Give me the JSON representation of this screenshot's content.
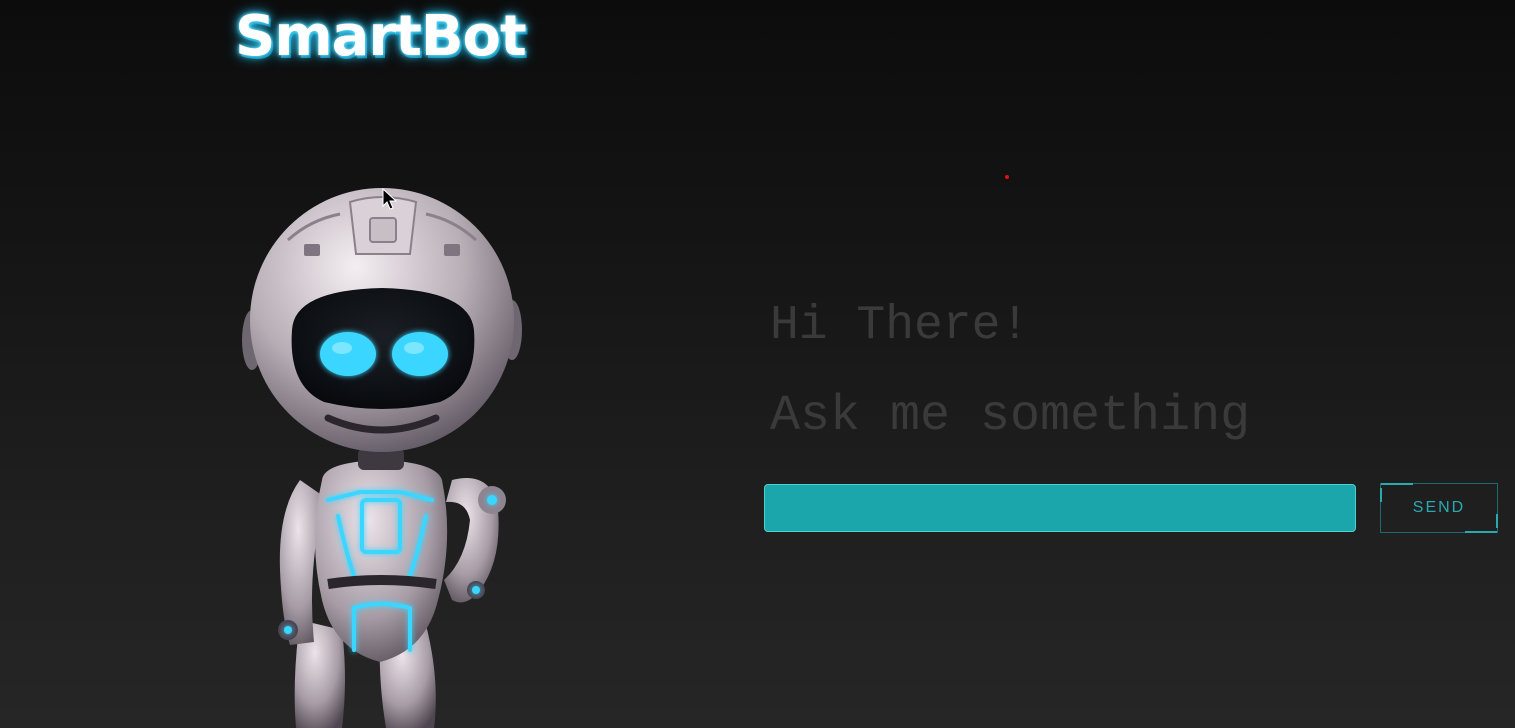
{
  "app": {
    "logo_text": "SmartBot"
  },
  "greeting": {
    "line1": "Hi There!",
    "line2": "Ask me something"
  },
  "chat": {
    "input_value": "",
    "input_placeholder": "",
    "send_label": "SEND"
  },
  "colors": {
    "accent": "#1aa6ab",
    "logo_glow": "#32c6ee",
    "robot_glow": "#3ad6ff",
    "greeting_text": "#3a3a3a",
    "background_top": "#0c0c0c",
    "background_bottom": "#262626"
  },
  "icons": {
    "robot": "robot-mascot",
    "cursor": "mouse-pointer-icon"
  }
}
